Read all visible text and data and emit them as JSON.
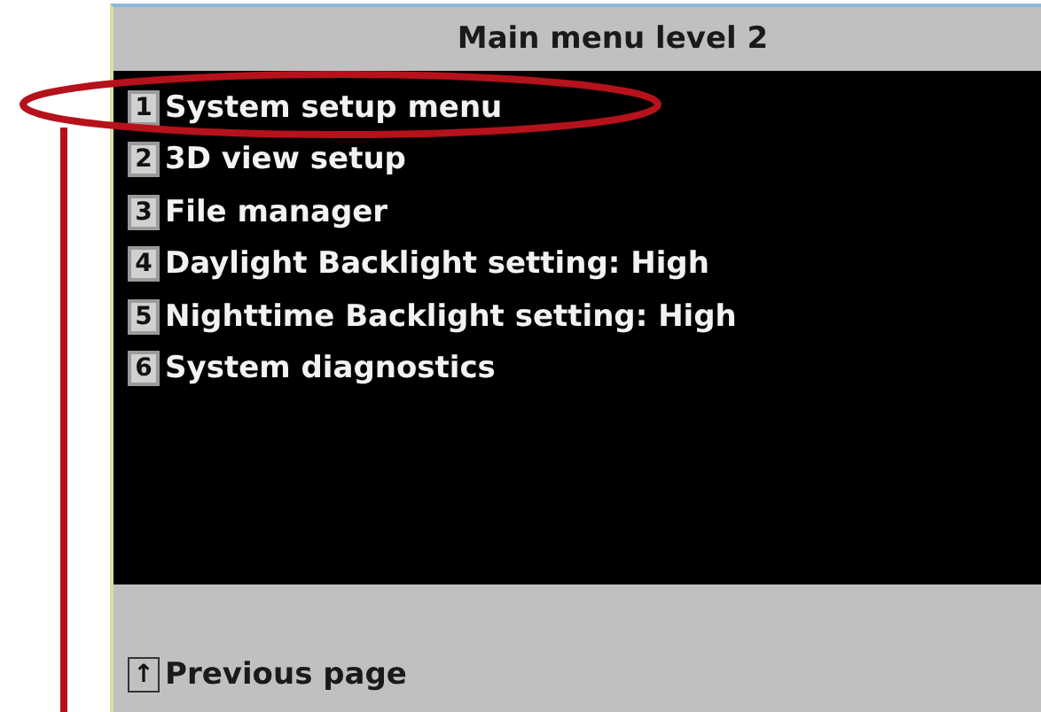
{
  "title": "Main menu level 2",
  "items": [
    {
      "key": "1",
      "label": "System setup menu"
    },
    {
      "key": "2",
      "label": "3D view setup"
    },
    {
      "key": "3",
      "label": "File manager"
    },
    {
      "key": "4",
      "label": "Daylight Backlight setting: High"
    },
    {
      "key": "5",
      "label": "Nighttime Backlight setting: High"
    },
    {
      "key": "6",
      "label": "System diagnostics"
    }
  ],
  "footer": {
    "key": "↑",
    "label": "Previous page"
  }
}
